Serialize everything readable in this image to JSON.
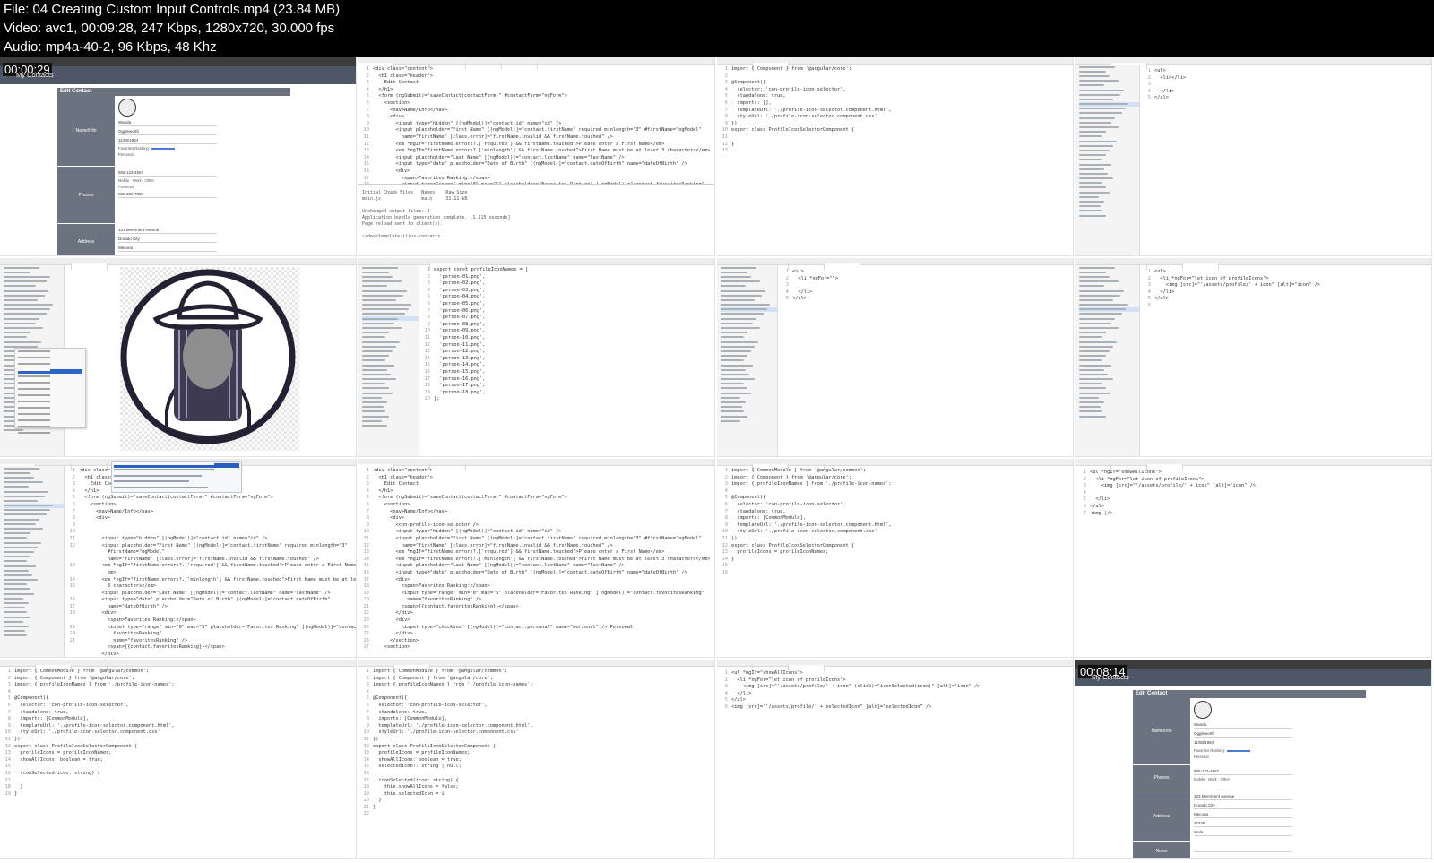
{
  "header": {
    "file_line": "File: 04  Creating Custom Input Controls.mp4 (23.84 MB)",
    "video_line": "Video: avc1, 00:09:28, 247 Kbps, 1280x720, 30.000 fps",
    "audio_line": "Audio: mp4a-40-2, 96 Kbps, 48 Khz"
  },
  "thumb1": {
    "timestamp": "00:00:29",
    "brand": "My Contacts",
    "panel_title": "Edit Contact",
    "name_label": "Name/Info",
    "first_name": "Wanda",
    "last_name": "Oggleworth",
    "dob": "11/08/1994",
    "favorites": "Favorites Ranking:",
    "personal": "Personal",
    "phones_label": "Phones",
    "phone1": "555-123-4567",
    "phone2": "555-321-7890",
    "mobile": "Mobile",
    "work": "Work",
    "other": "Other",
    "preferred": "Preferred",
    "address_label": "Address",
    "street": "123 Merriment Avenue",
    "city": "Dorado City",
    "state": "Mecona"
  },
  "thumb2": {
    "code": "<div class=\"content\">\n  <h1 class=\"header\">\n    Edit Contact\n  </h1>\n  <form (ngSubmit)=\"saveContact(contactForm)\" #contactForm=\"ngForm\">\n    <section>\n      <nav>Name/Info</nav>\n      <div>\n        <input type=\"hidden\" [(ngModel)]=\"contact.id\" name=\"id\" />\n        <input placeholder=\"First Name\" [(ngModel)]=\"contact.firstName\" required minlength=\"3\" #firstName=\"ngModel\"\n          name=\"firstName\" [class.error]=\"firstName.invalid && firstName.touched\" />\n        <em *ngIf=\"firstName.errors?.['required'] && firstName.touched\">Please enter a First Name</em>\n        <em *ngIf=\"firstName.errors?.['minlength'] && firstName.touched\">First Name must be at least 3 characters</em>\n        <input placeholder=\"Last Name\" [(ngModel)]=\"contact.lastName\" name=\"lastName\" />\n        <input type=\"date\" placeholder=\"Date of Birth\" [(ngModel)]=\"contact.dateOfBirth\" name=\"dateOfBirth\" />\n        <div>\n          <span>Favorites Ranking:</span>\n          <input type=\"range\" min=\"0\" max=\"5\" placeholder=\"Favorites Ranking\" [(ngModel)]=\"contact.favoritesRanking\"",
    "terminal": "Initial Chunk Files   Names    Raw Size\nmain.js               main     31.11 kB\n\nUnchanged output files: 3\nApplication bundle generation complete. [1.115 seconds]\nPage reload sent to client(s).\n\n~/dev/template-ilios-contacts"
  },
  "thumb3": {
    "code": "import { Component } from '@angular/core';\n\n@Component({\n  selector: 'con-profile-icon-selector',\n  standalone: true,\n  imports: [],\n  templateUrl: './profile-icon-selector.component.html',\n  styleUrl: './profile-icon-selector.component.css'\n})\nexport class ProfileIconSelectorComponent {\n\n}\n"
  },
  "thumb4": {
    "code": "<ul>\n  <li></li>\n\n  </li>\n</ul>"
  },
  "thumb6": {
    "code": "export const profileIconNames = [\n  'person-01.png',\n  'person-02.png',\n  'person-03.png',\n  'person-04.png',\n  'person-05.png',\n  'person-06.png',\n  'person-07.png',\n  'person-08.png',\n  'person-09.png',\n  'person-10.png',\n  'person-11.png',\n  'person-12.png',\n  'person-13.png',\n  'person-14.png',\n  'person-15.png',\n  'person-16.png',\n  'person-17.png',\n  'person-18.png',\n];"
  },
  "thumb7": {
    "code": "<ul>\n  <li *ngFor=\"\">\n\n  </li>\n</ul>"
  },
  "thumb8": {
    "code": "<ul>\n  <li *ngFor=\"let icon of profileIcons\">\n    <img [src]=\"'/assets/profile/' + icon\" [alt]=\"icon\" />\n  </li>\n</ul>"
  },
  "thumb9": {
    "code": "<div class=\"content\">\n  <h1 class=\"header\">\n    Edit Contact\n  </h1>\n  <form (ngSubmit)=\"saveContact(contactForm)\" #contactForm=\"ngForm\">\n    <section>\n      <nav>Name/Info</nav>\n      <div>\n\n\n        <input type=\"hidden\" [(ngModel)]=\"contact.id\" name=\"id\" />\n        <input placeholder=\"First Name\" [(ngModel)]=\"contact.firstName\" required minlength=\"3\"\n          #firstName=\"ngModel\"\n          name=\"firstName\" [class.error]=\"firstName.invalid && firstName.touched\" />\n        <em *ngIf=\"firstName.errors?.['required'] && firstName.touched\">Please enter a First Name</\n          em>\n        <em *ngIf=\"firstName.errors?.['minlength'] && firstName.touched\">First Name must be at least\n          3 characters</em>\n        <input placeholder=\"Last Name\" [(ngModel)]=\"contact.lastName\" name=\"lastName\" />\n        <input type=\"date\" placeholder=\"Date of Birth\" [(ngModel)]=\"contact.dateOfBirth\"\n          name=\"dateOfBirth\" />\n        <div>\n          <span>Favorites Ranking:</span>\n          <input type=\"range\" min=\"0\" max=\"5\" placeholder=\"Favorites Ranking\" [(ngModel)]=\"contact.\n            favoritesRanking\"\n            name=\"favoritesRanking\" />\n          <span>{{contact.favoritesRanking}}</span>\n        </div>"
  },
  "thumb10": {
    "code": "<div class=\"content\">\n  <h1 class=\"header\">\n    Edit Contact\n  </h1>\n  <form (ngSubmit)=\"saveContact(contactForm)\" #contactForm=\"ngForm\">\n    <section>\n      <nav>Name/Info</nav>\n      <div>\n        <con-profile-icon-selector />\n        <input type=\"hidden\" [(ngModel)]=\"contact.id\" name=\"id\" />\n        <input placeholder=\"First Name\" [(ngModel)]=\"contact.firstName\" required minlength=\"3\" #firstName=\"ngModel\"\n          name=\"firstName\" [class.error]=\"firstName.invalid && firstName.touched\" />\n        <em *ngIf=\"firstName.errors?.['required'] && firstName.touched\">Please enter a First Name</em>\n        <em *ngIf=\"firstName.errors?.['minlength'] && firstName.touched\">First Name must be at least 3 characters</em>\n        <input placeholder=\"Last Name\" [(ngModel)]=\"contact.lastName\" name=\"lastName\" />\n        <input type=\"date\" placeholder=\"Date of Birth\" [(ngModel)]=\"contact.dateOfBirth\" name=\"dateOfBirth\" />\n        <div>\n          <span>Favorites Ranking:</span>\n          <input type=\"range\" min=\"0\" max=\"5\" placeholder=\"Favorites Ranking\" [(ngModel)]=\"contact.favoritesRanking\"\n            name=\"favoritesRanking\" />\n          <span>{{contact.favoritesRanking}}</span>\n        </div>\n        <div>\n          <input type=\"checkbox\" [(ngModel)]=\"contact.personal\" name=\"personal\" /> Personal\n        </div>\n      </section>\n    <section>"
  },
  "thumb11": {
    "code": "import { CommonModule } from '@angular/common';\nimport { Component } from '@angular/core';\nimport { profileIconNames } from './profile-icon-names';\n\n@Component({\n  selector: 'con-profile-icon-selector',\n  standalone: true,\n  imports: [CommonModule],\n  templateUrl: './profile-icon-selector.component.html',\n  styleUrl: './profile-icon-selector.component.css'\n})\nexport class ProfileIconSelectorComponent {\n  profileIcons = profileIconNames;\n}\n"
  },
  "thumb12": {
    "code": "<ul *ngIf=\"showAllIcons\">\n  <li *ngFor=\"let icon of profileIcons\">\n    <img [src]=\"'/assets/profile/' + icon\" [alt]=\"icon\" />\n\n  </li>\n</ul>\n<img |/>"
  },
  "thumb13": {
    "code": "import { CommonModule } from '@angular/common';\nimport { Component } from '@angular/core';\nimport { profileIconNames } from './profile-icon-names';\n\n@Component({\n  selector: 'con-profile-icon-selector',\n  standalone: true,\n  imports: [CommonModule],\n  templateUrl: './profile-icon-selector.component.html',\n  styleUrl: './profile-icon-selector.component.css'\n})\nexport class ProfileIconSelectorComponent {\n  profileIcons = profileIconNames;\n  showAllIcons: boolean = true;\n\n  iconSelected(icon: string) {\n\n  }\n}\n"
  },
  "thumb14": {
    "code": "import { CommonModule } from '@angular/common';\nimport { Component } from '@angular/core';\nimport { profileIconNames } from './profile-icon-names';\n\n@Component({\n  selector: 'con-profile-icon-selector',\n  standalone: true,\n  imports: [CommonModule],\n  templateUrl: './profile-icon-selector.component.html',\n  styleUrl: './profile-icon-selector.component.css'\n})\nexport class ProfileIconSelectorComponent {\n  profileIcons = profileIconNames;\n  showAllIcons: boolean = true;\n  selectedIcon!: string | null;\n\n  iconSelected(icon: string) {\n    this.showAllIcons = false;\n    this.selectedIcon = i\n  }\n}\n"
  },
  "thumb15": {
    "code": "<ul *ngIf=\"showAllIcons\">\n  <li *ngFor=\"let icon of profileIcons\">\n    <img [src]=\"'/assets/profile/' + icon\" (click)=\"iconSelected(icon)\" [alt]=\"icon\" />\n  </li>\n</ul>\n<img [src]=\"'/assets/profile/' + selectedIcon\" [alt]=\"selectedIcon\" />"
  },
  "thumb16": {
    "timestamp": "00:08:14",
    "brand": "My Contacts",
    "panel_title": "Edit Contact",
    "name_label": "Name/Info",
    "first_name": "Wanda",
    "last_name": "Oggleworth",
    "dob": "11/08/1994",
    "favorites": "Favorites Ranking:",
    "personal": "Personal",
    "phones_label": "Phones",
    "phone1": "555-123-4567",
    "mobile": "Mobile",
    "work": "Work",
    "other": "Other",
    "address_label": "Address",
    "street": "123 Merriment Avenue",
    "city": "Dorado City",
    "state": "Mecona",
    "zip": "22345",
    "addr_type": "Work",
    "notes_label": "Notes"
  }
}
